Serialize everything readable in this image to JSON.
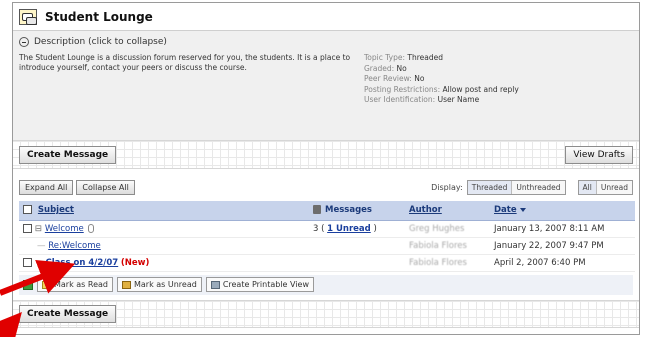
{
  "forum": {
    "title": "Student Lounge",
    "description_toggle": "Description (click to collapse)",
    "description_text": "The Student Lounge is a discussion forum reserved for you, the students. It is a place to introduce yourself, contact your peers or discuss the course.",
    "properties": [
      {
        "label": "Topic Type:",
        "value": "Threaded"
      },
      {
        "label": "Graded:",
        "value": "No"
      },
      {
        "label": "Peer Review:",
        "value": "No"
      },
      {
        "label": "Posting Restrictions:",
        "value": "Allow post and reply"
      },
      {
        "label": "User Identification:",
        "value": "User Name"
      }
    ]
  },
  "actions": {
    "create_message": "Create Message",
    "view_drafts": "View Drafts"
  },
  "toolbar": {
    "expand_all": "Expand All",
    "collapse_all": "Collapse All",
    "display_label": "Display:",
    "threaded": "Threaded",
    "unthreaded": "Unthreaded",
    "all": "All",
    "unread": "Unread"
  },
  "table": {
    "headers": {
      "subject": "Subject",
      "messages": "Messages",
      "author": "Author",
      "date": "Date"
    },
    "rows": [
      {
        "subject": "Welcome",
        "messages_count": "3 (",
        "messages_link": "1 Unread",
        "messages_close": ")",
        "author": "Greg Hughes",
        "date": "January 13, 2007 8:11 AM"
      },
      {
        "subject": "Re:Welcome",
        "author": "Fabiola Flores",
        "date": "January 22, 2007 9:47 PM"
      },
      {
        "subject": "Class on 4/2/07",
        "badge": "(New)",
        "author": "Fabiola Flores",
        "date": "April 2, 2007 6:40 PM"
      }
    ]
  },
  "bottom_tools": {
    "mark_read": "Mark as Read",
    "mark_unread": "Mark as Unread",
    "printable": "Create Printable View"
  },
  "annotations": {
    "arrow_color": "#e00000"
  }
}
